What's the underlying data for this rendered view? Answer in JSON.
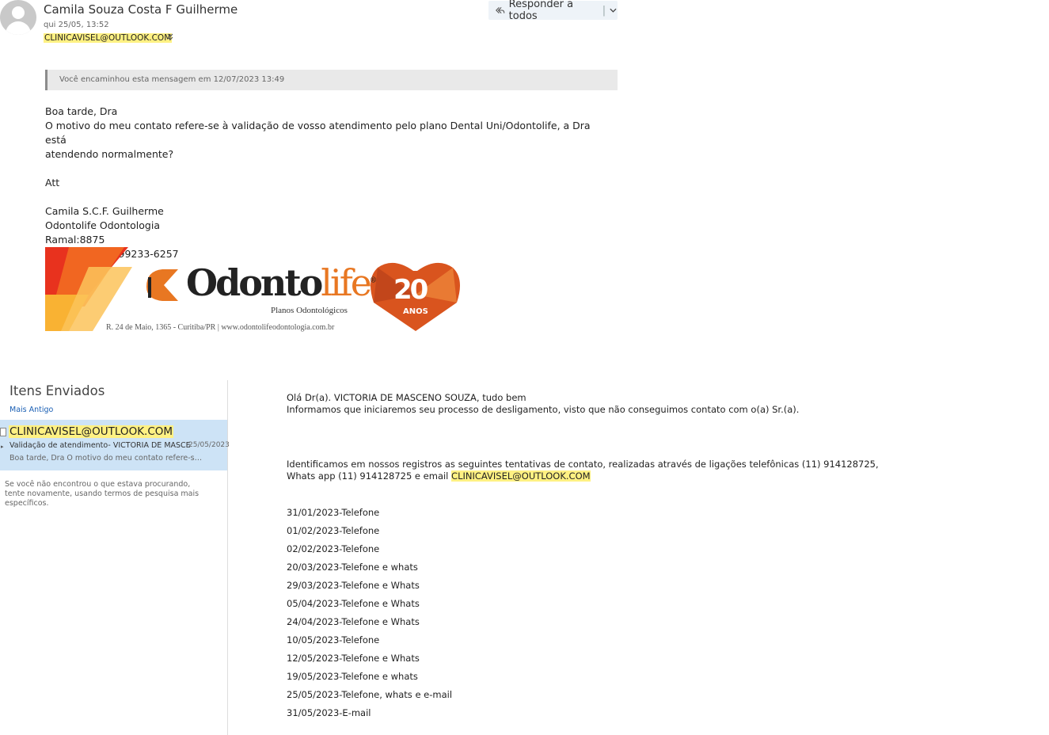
{
  "message": {
    "sender_name": "Camila Souza Costa F Guilherme",
    "date": "qui 25/05, 13:52",
    "sender_email": "CLINICAVISEL@OUTLOOK.COM",
    "reply_all_label": "Responder a todos",
    "forwarded_notice": "Você encaminhou esta mensagem em 12/07/2023 13:49",
    "body_lines": [
      "Boa tarde, Dra",
      "O motivo do meu contato refere-se à validação de vosso atendimento pelo plano Dental Uni/Odontolife, a Dra está",
      "atendendo normalmente?",
      "",
      "Att",
      "",
      "Camila S.C.F. Guilherme",
      "Odontolife Odontologia",
      "Ramal:8875",
      "Whatsapp (41)99233-6257"
    ]
  },
  "signature_logo": {
    "brand_part1": "Odonto",
    "brand_part2": "life",
    "registered_mark": "®",
    "subtitle": "Planos Odontológicos",
    "address_line": "R. 24 de Maio, 1365 - Curitiba/PR  |  www.odontolifeodontologia.com.br",
    "badge_number": "20",
    "badge_text": "ANOS",
    "colors": {
      "orange": "#e87722",
      "red": "#e8321e",
      "yellow": "#f9b233"
    }
  },
  "folder_pane": {
    "title": "Itens Enviados",
    "sort_label": "Mais Antigo",
    "item": {
      "from": "CLINICAVISEL@OUTLOOK.COM",
      "subject": "Validação de atendimento- VICTORIA DE MASCE",
      "date": "25/05/2023",
      "preview": "Boa tarde, Dra O motivo do meu contato refere-se à vali..."
    },
    "search_hint": "Se você não encontrou o que estava procurando, tente novamente, usando termos de pesquisa mais específicos."
  },
  "reading_pane": {
    "greeting": "Olá Dr(a). VICTORIA DE MASCENO SOUZA, tudo bem",
    "notice": "Informamos que iniciaremos seu processo de desligamento, visto que não conseguimos contato com o(a) Sr.(a).",
    "contact_text": "Identificamos em nossos registros as seguintes tentativas de contato, realizadas através de ligações telefônicas (11) 914128725, Whats app (11) 914128725 e email",
    "contact_email": "CLINICAVISEL@OUTLOOK.COM",
    "attempts": [
      "31/01/2023-Telefone",
      "01/02/2023-Telefone",
      "02/02/2023-Telefone",
      "20/03/2023-Telefone e whats",
      "29/03/2023-Telefone e Whats",
      "05/04/2023-Telefone e Whats",
      "24/04/2023-Telefone e Whats",
      "10/05/2023-Telefone",
      "12/05/2023-Telefone e Whats",
      "19/05/2023-Telefone e whats",
      "25/05/2023-Telefone, whats e e-mail",
      "31/05/2023-E-mail"
    ]
  },
  "icons": {
    "avatar": "user-avatar-icon",
    "reply_all": "reply-all-icon",
    "dropdown": "chevron-down-icon",
    "expand": "double-chevron-down-icon"
  }
}
